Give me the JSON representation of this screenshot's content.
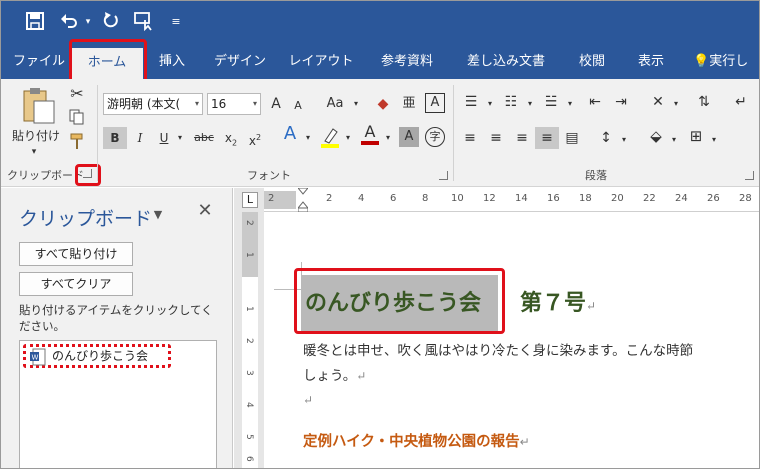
{
  "window": {
    "qat": [
      "save-icon",
      "undo-icon",
      "redo-icon",
      "touch-mode-icon",
      "customize-qat-icon"
    ]
  },
  "tabs": [
    {
      "label": "ファイル",
      "active": false
    },
    {
      "label": "ホーム",
      "active": true
    },
    {
      "label": "挿入",
      "active": false
    },
    {
      "label": "デザイン",
      "active": false
    },
    {
      "label": "レイアウト",
      "active": false
    },
    {
      "label": "参考資料",
      "active": false
    },
    {
      "label": "差し込み文書",
      "active": false
    },
    {
      "label": "校閲",
      "active": false
    },
    {
      "label": "表示",
      "active": false
    },
    {
      "label": "実行し",
      "active": false,
      "icon": "lightbulb-icon"
    }
  ],
  "ribbon": {
    "clipboard": {
      "paste_label": "貼り付け",
      "group_label": "クリップボード"
    },
    "font": {
      "font_name": "游明朝 (本文(",
      "font_size": "16",
      "grow": "A",
      "shrink": "A",
      "change_case": "Aa",
      "bold": "B",
      "italic": "I",
      "underline": "U",
      "strike": "abc",
      "subscript": "x",
      "superscript": "x",
      "subscript_mark": "2",
      "superscript_mark": "2",
      "group_label": "フォント"
    },
    "paragraph": {
      "group_label": "段落"
    },
    "accent_color": "#2b579a",
    "highlight_color": "#ffff00",
    "font_color": "#c00000"
  },
  "clipboard_pane": {
    "title": "クリップボード",
    "paste_all": "すべて貼り付け",
    "clear_all": "すべてクリア",
    "hint": "貼り付けるアイテムをクリックしてください。",
    "items": [
      {
        "text": "のんびり歩こう会",
        "icon": "word-doc-icon"
      }
    ]
  },
  "ruler": {
    "ticks": [
      "2",
      "2",
      "4",
      "6",
      "8",
      "10",
      "12",
      "14",
      "16",
      "18",
      "20",
      "22",
      "24",
      "26",
      "28"
    ],
    "vticks": [
      "2",
      "1",
      "1",
      "2",
      "3",
      "4",
      "5",
      "6"
    ],
    "corner": "L"
  },
  "document": {
    "title": "のんびり歩こう会",
    "issue": "第７号",
    "line1": "暖冬とは申せ、吹く風はやはり冷たく身に染みます。こんな時節",
    "line2": "しょう。",
    "heading": "定例ハイク・中央植物公園の報告",
    "para_mark": "↵",
    "title_color": "#385723",
    "heading_color": "#c55a11"
  },
  "annotation_color": "#e0101a"
}
